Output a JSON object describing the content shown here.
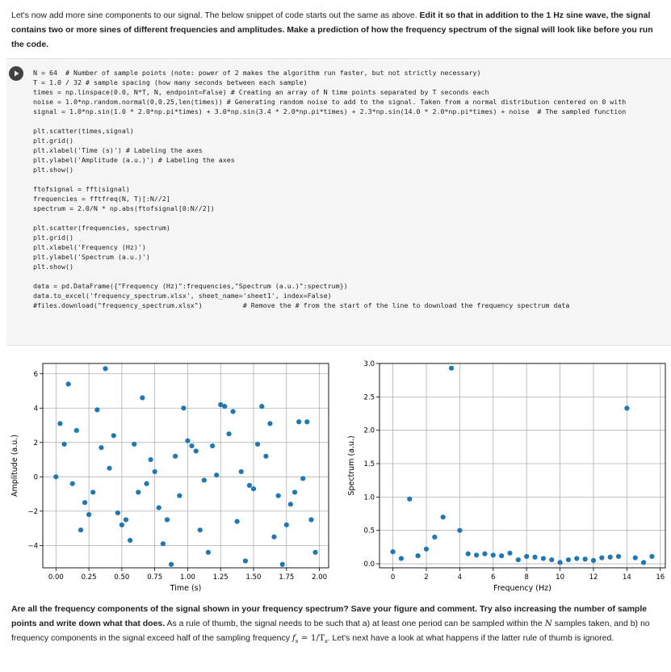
{
  "intro": {
    "text_plain_1": "Let's now add more sine components to our signal. The below snippet of code starts out the same as above. ",
    "text_bold": "Edit it so that in addition to the 1 Hz sine wave, the signal contains two or more sines of different frequencies and amplitudes. Make a prediction of how the frequency spectrum of the signal will look like before you run the code."
  },
  "code_lines": [
    "N = 64  # Number of sample points (note: power of 2 makes the algorithm run faster, but not strictly necessary)",
    "T = 1.0 / 32 # sample spacing (how many seconds between each sample)",
    "times = np.linspace(0.0, N*T, N, endpoint=False) # Creating an array of N time points separated by T seconds each",
    "noise = 1.0*np.random.normal(0,0.25,len(times)) # Generating random noise to add to the signal. Taken from a normal distribution centered on 0 with",
    "signal = 1.0*np.sin(1.0 * 2.0*np.pi*times) + 3.0*np.sin(3.4 * 2.0*np.pi*times) + 2.3*np.sin(14.0 * 2.0*np.pi*times) + noise  # The sampled function",
    "",
    "plt.scatter(times,signal)",
    "plt.grid()",
    "plt.xlabel('Time (s)') # Labeling the axes",
    "plt.ylabel('Amplitude (a.u.)') # Labeling the axes",
    "plt.show()",
    "",
    "ftofsignal = fft(signal)",
    "frequencies = fftfreq(N, T)[:N//2]",
    "spectrum = 2.0/N * np.abs(ftofsignal[0:N//2])",
    "",
    "plt.scatter(frequencies, spectrum)",
    "plt.grid()",
    "plt.xlabel('Frequency (Hz)')",
    "plt.ylabel('Spectrum (a.u.)')",
    "plt.show()",
    "",
    "data = pd.DataFrame({\"Frequency (Hz)\":frequencies,\"Spectrum (a.u.)\":spectrum})",
    "data.to_excel('frequency_spectrum.xlsx', sheet_name='sheet1', index=False)",
    "#files.download(\"frequency_spectrum.xlsx\")          # Remove the # from the start of the line to download the frequency spectrum data"
  ],
  "outro": {
    "bold_1": "Are all the frequency components of the signal shown in your frequency spectrum? Save your figure and comment. Try also increasing the number of sample points and write down what that does.",
    "plain_1": " As a rule of thumb, the signal needs to be such that a) at least one period can be sampled within the ",
    "math_N": "N",
    "plain_2": " samples taken, and b) no frequency components in the signal exceed half of the sampling frequency ",
    "math_fs": "f",
    "math_fs_sub": "s",
    "math_eq": " = 1/T",
    "math_T_sub": "s",
    "plain_3": ". Let's next have a look at what happens if the latter rule of thumb is ignored."
  },
  "colors": {
    "marker": "#1f77b4",
    "grid": "#b0b0b0",
    "axis": "#000000",
    "run_button": "#424242"
  },
  "icons": {
    "run": "play-icon"
  },
  "chart_data": [
    {
      "type": "scatter",
      "xlabel": "Time (s)",
      "ylabel": "Amplitude (a.u.)",
      "xlim": [
        -0.1,
        2.07
      ],
      "ylim": [
        -5.3,
        6.6
      ],
      "xticks": [
        0.0,
        0.25,
        0.5,
        0.75,
        1.0,
        1.25,
        1.5,
        1.75,
        2.0
      ],
      "xtick_labels": [
        "0.00",
        "0.25",
        "0.50",
        "0.75",
        "1.00",
        "1.25",
        "1.50",
        "1.75",
        "2.00"
      ],
      "yticks": [
        -4,
        -2,
        0,
        2,
        4,
        6
      ],
      "ytick_labels": [
        "−4",
        "−2",
        "0",
        "2",
        "4",
        "6"
      ],
      "grid": true,
      "points": [
        [
          0.0,
          0.0
        ],
        [
          0.031,
          3.1
        ],
        [
          0.063,
          1.9
        ],
        [
          0.094,
          5.4
        ],
        [
          0.125,
          -0.4
        ],
        [
          0.156,
          2.7
        ],
        [
          0.188,
          -3.1
        ],
        [
          0.219,
          -1.5
        ],
        [
          0.25,
          -2.2
        ],
        [
          0.281,
          -0.9
        ],
        [
          0.313,
          3.9
        ],
        [
          0.344,
          1.7
        ],
        [
          0.375,
          6.3
        ],
        [
          0.406,
          0.5
        ],
        [
          0.438,
          2.4
        ],
        [
          0.469,
          -2.1
        ],
        [
          0.5,
          -2.8
        ],
        [
          0.531,
          -2.5
        ],
        [
          0.563,
          -3.7
        ],
        [
          0.594,
          1.9
        ],
        [
          0.625,
          -0.9
        ],
        [
          0.656,
          4.6
        ],
        [
          0.688,
          -0.4
        ],
        [
          0.719,
          1.0
        ],
        [
          0.75,
          0.3
        ],
        [
          0.781,
          -1.8
        ],
        [
          0.813,
          -3.9
        ],
        [
          0.844,
          -2.5
        ],
        [
          0.875,
          -5.1
        ],
        [
          0.906,
          1.2
        ],
        [
          0.938,
          -1.1
        ],
        [
          0.969,
          4.0
        ],
        [
          1.0,
          2.1
        ],
        [
          1.031,
          1.8
        ],
        [
          1.063,
          1.5
        ],
        [
          1.094,
          -3.1
        ],
        [
          1.125,
          -0.2
        ],
        [
          1.156,
          -4.4
        ],
        [
          1.188,
          1.8
        ],
        [
          1.219,
          0.1
        ],
        [
          1.25,
          4.2
        ],
        [
          1.281,
          4.1
        ],
        [
          1.313,
          2.5
        ],
        [
          1.344,
          3.8
        ],
        [
          1.375,
          -2.6
        ],
        [
          1.406,
          0.3
        ],
        [
          1.438,
          -4.9
        ],
        [
          1.469,
          -0.5
        ],
        [
          1.5,
          -0.7
        ],
        [
          1.531,
          1.9
        ],
        [
          1.563,
          4.1
        ],
        [
          1.594,
          1.2
        ],
        [
          1.625,
          3.1
        ],
        [
          1.656,
          -3.5
        ],
        [
          1.688,
          -1.1
        ],
        [
          1.719,
          -5.1
        ],
        [
          1.75,
          -2.8
        ],
        [
          1.781,
          -1.6
        ],
        [
          1.813,
          -0.9
        ],
        [
          1.844,
          3.2
        ],
        [
          1.875,
          -0.1
        ],
        [
          1.906,
          3.2
        ],
        [
          1.938,
          -2.5
        ],
        [
          1.969,
          -4.4
        ]
      ]
    },
    {
      "type": "scatter",
      "xlabel": "Frequency (Hz)",
      "ylabel": "Spectrum (a.u.)",
      "xlim": [
        -0.8,
        16.3
      ],
      "ylim": [
        -0.06,
        3.0
      ],
      "xticks": [
        0,
        2,
        4,
        6,
        8,
        10,
        12,
        14,
        16
      ],
      "xtick_labels": [
        "0",
        "2",
        "4",
        "6",
        "8",
        "10",
        "12",
        "14",
        "16"
      ],
      "yticks": [
        0.0,
        0.5,
        1.0,
        1.5,
        2.0,
        2.5,
        3.0
      ],
      "ytick_labels": [
        "0.0",
        "0.5",
        "1.0",
        "1.5",
        "2.0",
        "2.5",
        "3.0"
      ],
      "grid": true,
      "points": [
        [
          0.0,
          0.18
        ],
        [
          0.5,
          0.08
        ],
        [
          1.0,
          0.97
        ],
        [
          1.5,
          0.12
        ],
        [
          2.0,
          0.22
        ],
        [
          2.5,
          0.4
        ],
        [
          3.0,
          0.7
        ],
        [
          3.5,
          2.93
        ],
        [
          4.0,
          0.5
        ],
        [
          4.5,
          0.15
        ],
        [
          5.0,
          0.13
        ],
        [
          5.5,
          0.15
        ],
        [
          6.0,
          0.13
        ],
        [
          6.5,
          0.12
        ],
        [
          7.0,
          0.16
        ],
        [
          7.5,
          0.06
        ],
        [
          8.0,
          0.11
        ],
        [
          8.5,
          0.1
        ],
        [
          9.0,
          0.08
        ],
        [
          9.5,
          0.06
        ],
        [
          10.0,
          0.02
        ],
        [
          10.5,
          0.06
        ],
        [
          11.0,
          0.08
        ],
        [
          11.5,
          0.07
        ],
        [
          12.0,
          0.05
        ],
        [
          12.5,
          0.09
        ],
        [
          13.0,
          0.1
        ],
        [
          13.5,
          0.11
        ],
        [
          14.0,
          2.33
        ],
        [
          14.5,
          0.09
        ],
        [
          15.0,
          0.02
        ],
        [
          15.5,
          0.11
        ]
      ]
    }
  ]
}
